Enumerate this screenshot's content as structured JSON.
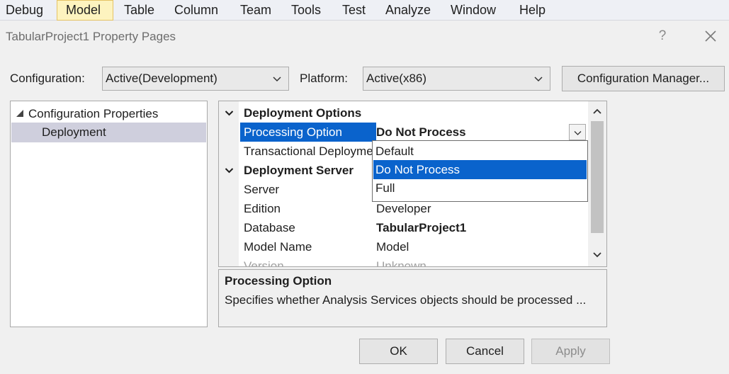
{
  "menu": {
    "items": [
      "Debug",
      "Model",
      "Table",
      "Column",
      "Team",
      "Tools",
      "Test",
      "Analyze",
      "Window",
      "Help"
    ],
    "active": "Model"
  },
  "dialog": {
    "title": "TabularProject1 Property Pages",
    "help": "?",
    "configuration_label": "Configuration:",
    "configuration_value": "Active(Development)",
    "platform_label": "Platform:",
    "platform_value": "Active(x86)",
    "config_manager_button": "Configuration Manager...",
    "ok_button": "OK",
    "cancel_button": "Cancel",
    "apply_button": "Apply"
  },
  "tree": {
    "root": "Configuration Properties",
    "children": [
      "Deployment"
    ]
  },
  "grid": {
    "categories": [
      {
        "title": "Deployment Options"
      },
      {
        "title": "Deployment Server"
      }
    ],
    "rows": [
      {
        "name": "Processing Option",
        "value": "Do Not Process"
      },
      {
        "name": "Transactional Deployment",
        "value": ""
      },
      {
        "name": "Server",
        "value": ""
      },
      {
        "name": "Edition",
        "value": "Developer"
      },
      {
        "name": "Database",
        "value": "TabularProject1"
      },
      {
        "name": "Model Name",
        "value": "Model"
      },
      {
        "name": "Version",
        "value": "Unknown"
      }
    ]
  },
  "dropdown": {
    "options": [
      "Default",
      "Do Not Process",
      "Full"
    ],
    "selected": "Do Not Process"
  },
  "description": {
    "title": "Processing Option",
    "text": "Specifies whether Analysis Services objects should be processed ..."
  },
  "colors": {
    "selection": "#0a63cc",
    "active_menu": "#fdf3bf"
  }
}
